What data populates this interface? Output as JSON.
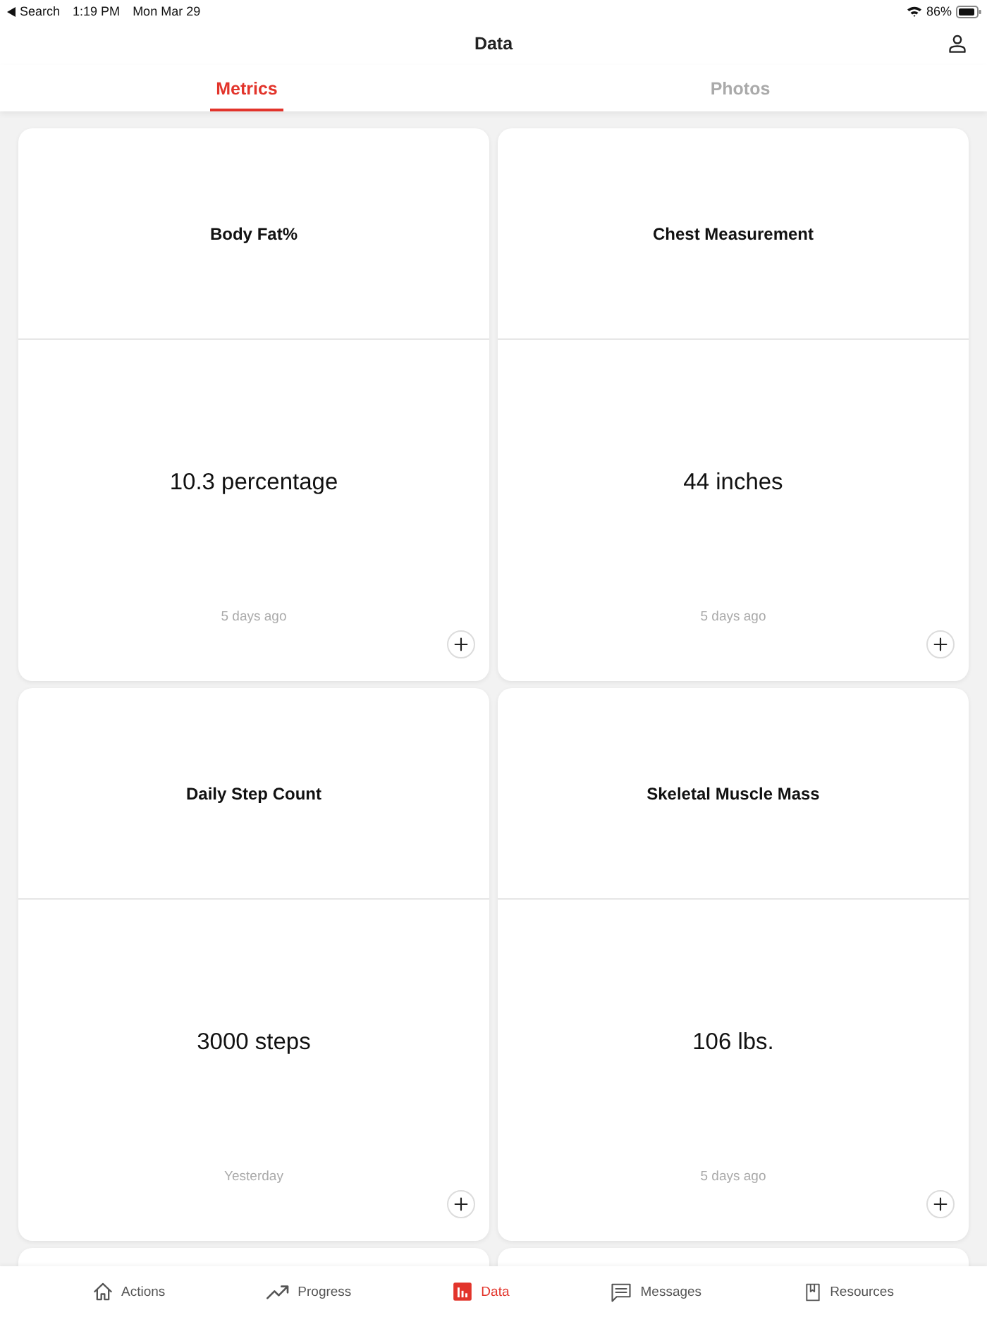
{
  "status_bar": {
    "back": "Search",
    "time": "1:19 PM",
    "date": "Mon Mar 29",
    "battery": "86%"
  },
  "header": {
    "title": "Data"
  },
  "tabs": [
    {
      "label": "Metrics",
      "selected": true
    },
    {
      "label": "Photos",
      "selected": false
    }
  ],
  "metrics": [
    {
      "title": "Body Fat%",
      "value": "10.3 percentage",
      "updated": "5 days ago"
    },
    {
      "title": "Chest Measurement",
      "value": "44 inches",
      "updated": "5 days ago"
    },
    {
      "title": "Daily Step Count",
      "value": "3000 steps",
      "updated": "Yesterday"
    },
    {
      "title": "Skeletal Muscle Mass",
      "value": "106 lbs.",
      "updated": "5 days ago"
    }
  ],
  "nav": [
    {
      "label": "Actions",
      "selected": false
    },
    {
      "label": "Progress",
      "selected": false
    },
    {
      "label": "Data",
      "selected": true
    },
    {
      "label": "Messages",
      "selected": false
    },
    {
      "label": "Resources",
      "selected": false
    }
  ]
}
